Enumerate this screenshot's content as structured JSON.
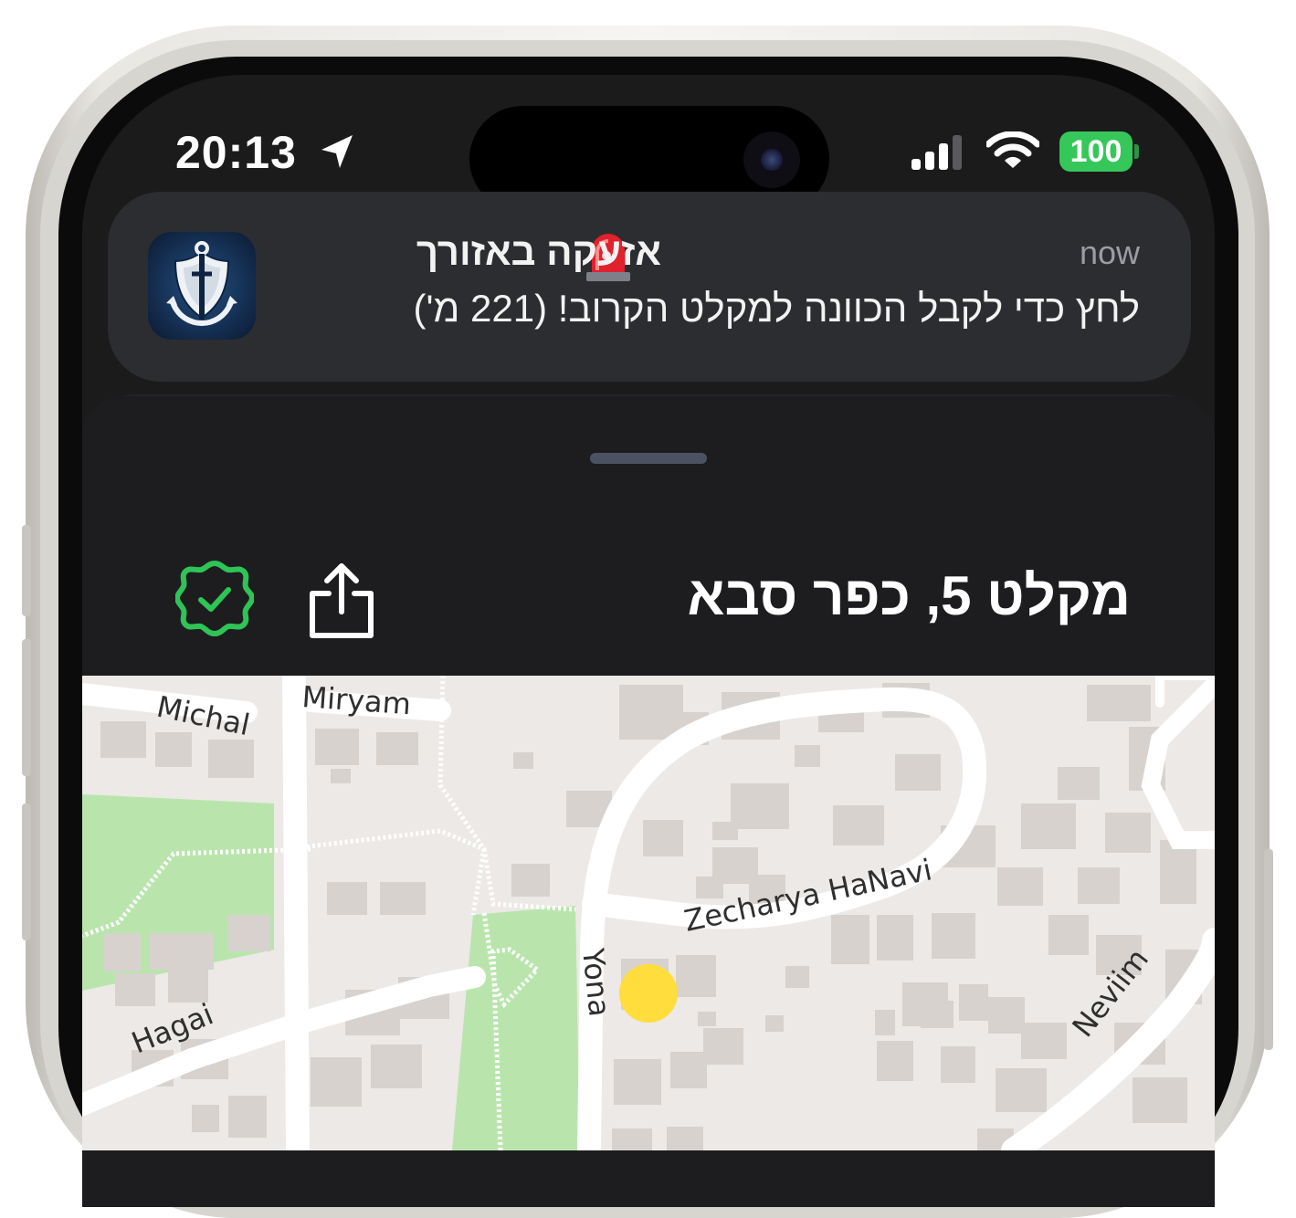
{
  "status_bar": {
    "time": "20:13",
    "battery": "100",
    "battery_color": "#35c759"
  },
  "notification": {
    "app_icon": "shield-anchor-icon",
    "title": "אזעקה באזורך",
    "title_emoji": "siren-icon",
    "time": "now",
    "body": "לחץ כדי לקבל הכוונה למקלט הקרוב! (221 מ')"
  },
  "sheet": {
    "title": "מקלט 5, כפר סבא",
    "share_icon": "share-icon",
    "verified_icon": "verified-badge-icon",
    "verified_color": "#2fc456"
  },
  "map": {
    "streets": [
      "Michal",
      "Miryam",
      "Zecharya HaNavi",
      "Yona",
      "Hagai",
      "Neviim"
    ],
    "marker_color": "#ffdd3c"
  }
}
